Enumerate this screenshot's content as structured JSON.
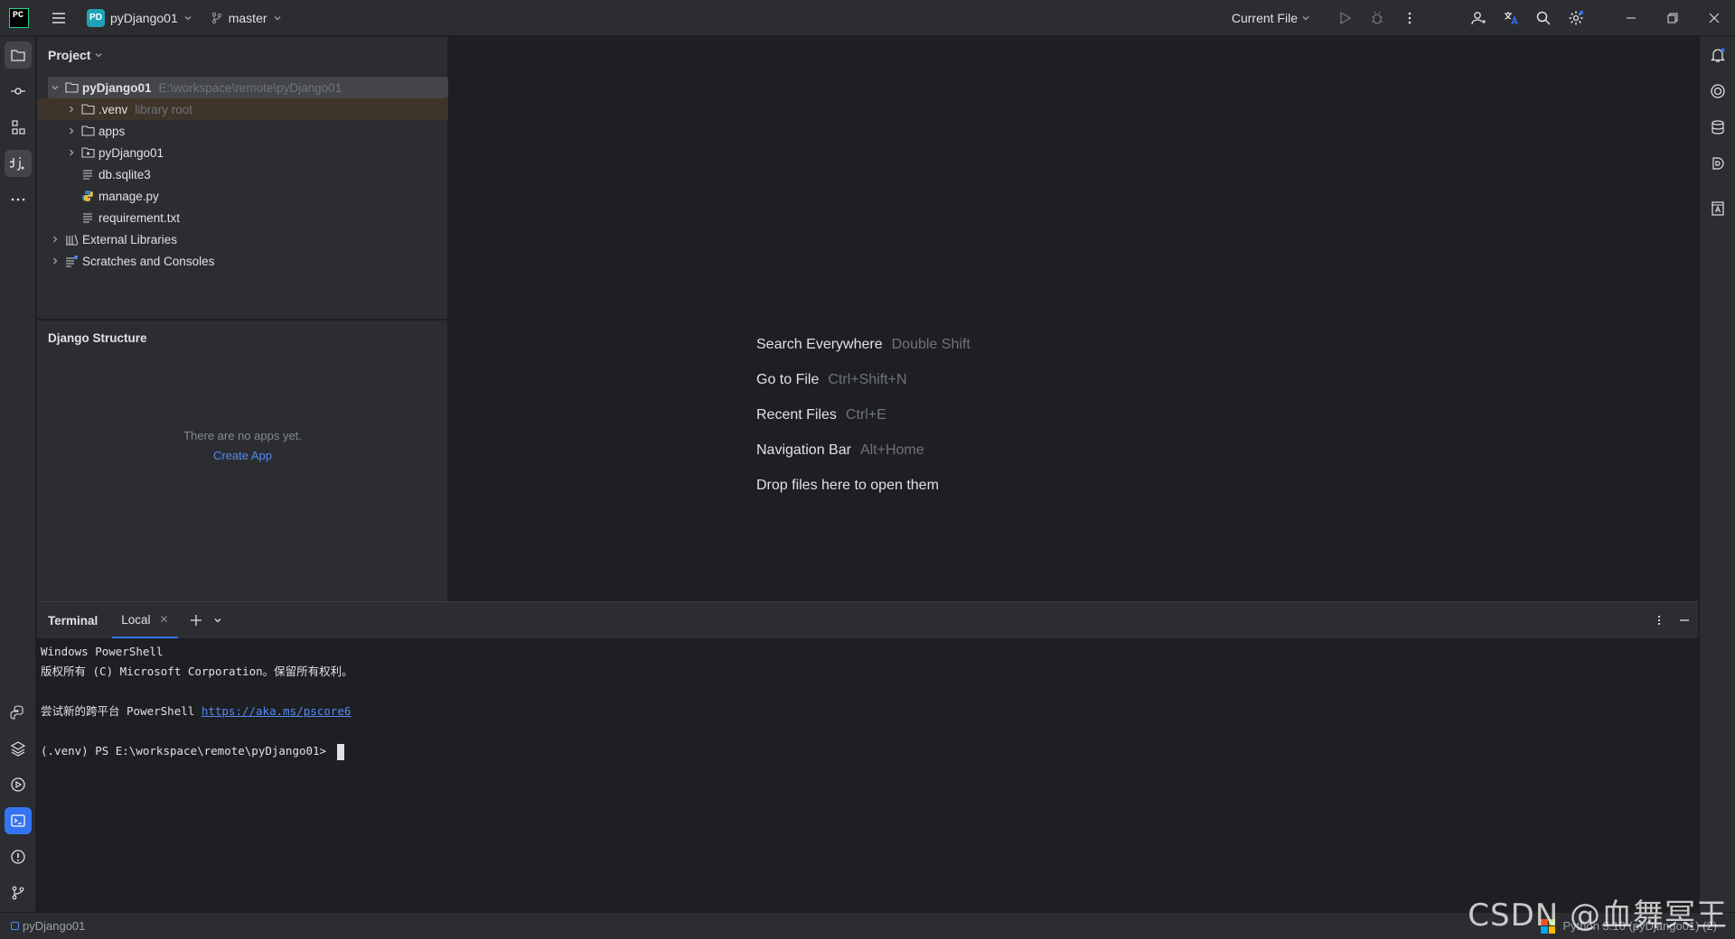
{
  "titlebar": {
    "logo_text": "PC",
    "project_badge": "PD",
    "project_name": "pyDjango01",
    "branch": "master",
    "run_config": "Current File"
  },
  "project_panel": {
    "title": "Project",
    "tree": [
      {
        "label": "pyDjango01",
        "hint": "E:\\workspace\\remote\\pyDjango01",
        "icon": "folder-icon",
        "expanded": true,
        "bold": true
      },
      {
        "label": ".venv",
        "hint": "library root",
        "icon": "folder-icon"
      },
      {
        "label": "apps",
        "hint": "",
        "icon": "folder-icon"
      },
      {
        "label": "pyDjango01",
        "hint": "",
        "icon": "package-folder-icon"
      },
      {
        "label": "db.sqlite3",
        "hint": "",
        "icon": "text-file-icon"
      },
      {
        "label": "manage.py",
        "hint": "",
        "icon": "python-file-icon"
      },
      {
        "label": "requirement.txt",
        "hint": "",
        "icon": "text-file-icon"
      },
      {
        "label": "External Libraries",
        "hint": "",
        "icon": "library-icon"
      },
      {
        "label": "Scratches and Consoles",
        "hint": "",
        "icon": "scratches-icon"
      }
    ]
  },
  "django_panel": {
    "title": "Django Structure",
    "empty_text": "There are no apps yet.",
    "create_link": "Create App"
  },
  "editor_hints": [
    {
      "action": "Search Everywhere",
      "shortcut": "Double Shift"
    },
    {
      "action": "Go to File",
      "shortcut": "Ctrl+Shift+N"
    },
    {
      "action": "Recent Files",
      "shortcut": "Ctrl+E"
    },
    {
      "action": "Navigation Bar",
      "shortcut": "Alt+Home"
    },
    {
      "action": "Drop files here to open them",
      "shortcut": ""
    }
  ],
  "terminal": {
    "title": "Terminal",
    "tab_label": "Local",
    "lines": {
      "l1": "Windows PowerShell",
      "l2": "版权所有 (C) Microsoft Corporation。保留所有权利。",
      "l3_prefix": "尝试新的跨平台 PowerShell ",
      "l3_link": "https://aka.ms/pscore6",
      "prompt": "(.venv) PS E:\\workspace\\remote\\pyDjango01> "
    }
  },
  "statusbar": {
    "project": "pyDjango01",
    "interpreter": "Python 3.10 (pyDjango01) (2)"
  },
  "watermark": "CSDN @血舞冥王",
  "colors": {
    "background": "#1e1f22",
    "panel": "#2b2d30",
    "accent": "#3574f0",
    "link": "#548af7"
  }
}
